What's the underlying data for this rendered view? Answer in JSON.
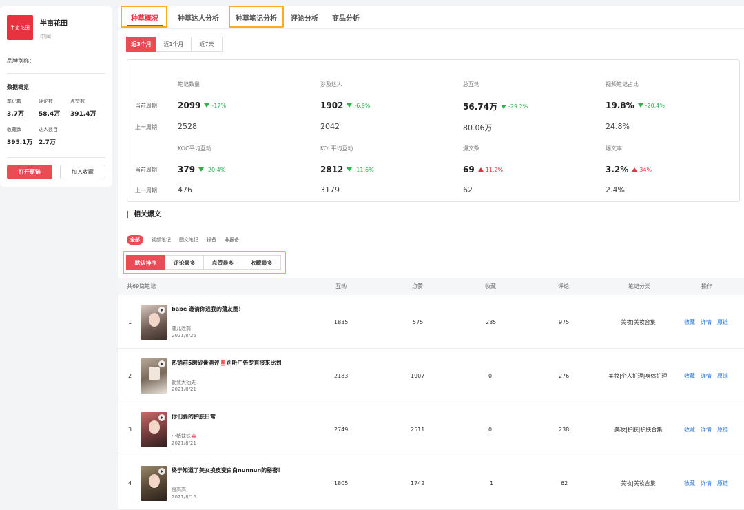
{
  "brand": {
    "logo_text": "半亩花田",
    "name": "半亩花田",
    "country": "中国",
    "alias_label": "品牌别称：",
    "overview_title": "数据概览",
    "stats": [
      {
        "label": "笔记数",
        "value": "3.7万"
      },
      {
        "label": "评论数",
        "value": "58.4万"
      },
      {
        "label": "点赞数",
        "value": "391.4万"
      },
      {
        "label": "收藏数",
        "value": "395.1万"
      },
      {
        "label": "达人数目",
        "value": "2.7万"
      }
    ],
    "open_link_label": "打开原链",
    "favorite_label": "加入收藏"
  },
  "tabs": [
    "种草概况",
    "种草达人分析",
    "种草笔记分析",
    "评论分析",
    "商品分析"
  ],
  "range_buttons": [
    "近3个月",
    "近1个月",
    "近7天"
  ],
  "period_labels": {
    "current": "当前周期",
    "previous": "上一周期"
  },
  "metrics": [
    {
      "name": "笔记数量",
      "current": "2099",
      "change": "-17%",
      "dir": "down",
      "previous": "2528"
    },
    {
      "name": "涉及达人",
      "current": "1902",
      "change": "-6.9%",
      "dir": "down",
      "previous": "2042"
    },
    {
      "name": "总互动",
      "current": "56.74万",
      "change": "-29.2%",
      "dir": "down",
      "previous": "80.06万"
    },
    {
      "name": "视频笔记占比",
      "current": "19.8%",
      "change": "-20.4%",
      "dir": "down",
      "previous": "24.8%"
    },
    {
      "name": "KOC平均互动",
      "current": "379",
      "change": "-20.4%",
      "dir": "down",
      "previous": "476"
    },
    {
      "name": "KOL平均互动",
      "current": "2812",
      "change": "-11.6%",
      "dir": "down",
      "previous": "3179"
    },
    {
      "name": "爆文数",
      "current": "69",
      "change": "11.2%",
      "dir": "up",
      "previous": "62"
    },
    {
      "name": "爆文率",
      "current": "3.2%",
      "change": "34%",
      "dir": "up",
      "previous": "2.4%"
    }
  ],
  "section_title": "相关爆文",
  "filters": [
    "全部",
    "视频笔记",
    "图文笔记",
    "报备",
    "非报备"
  ],
  "sort_buttons": [
    "默认排序",
    "评论最多",
    "点赞最多",
    "收藏最多"
  ],
  "table": {
    "headers": [
      "共69篇笔记",
      "互动",
      "点赞",
      "收藏",
      "评论",
      "笔记分类",
      "操作"
    ],
    "rows": [
      {
        "idx": "1",
        "title": "babe 邀请你进我的蒲友圈！",
        "author": "蒲儿姓蒲",
        "date": "2021/8/25",
        "interact": "1835",
        "likes": "575",
        "collects": "285",
        "comments": "975",
        "category": "美妆|美妆合集"
      },
      {
        "idx": "2",
        "title": "热销前5磨砂膏测评‼️别听广告专直接来比划",
        "author": "勤敛大抽夫",
        "date": "2021/8/21",
        "interact": "2183",
        "likes": "1907",
        "collects": "0",
        "comments": "276",
        "category": "美妆|个人护理|身体护理"
      },
      {
        "idx": "3",
        "title": "你们要的护肤日常",
        "author": "小猪妹妹🐽",
        "date": "2021/8/21",
        "interact": "2749",
        "likes": "2511",
        "collects": "0",
        "comments": "238",
        "category": "美妆|护肤|护肤合集"
      },
      {
        "idx": "4",
        "title": "终于知道了美女换皮变白白nunnun的秘密！",
        "author": "是高高",
        "date": "2021/8/16",
        "interact": "1805",
        "likes": "1742",
        "collects": "1",
        "comments": "62",
        "category": "美妆|美妆合集"
      }
    ],
    "ops": [
      "收藏",
      "详情",
      "原链"
    ]
  }
}
